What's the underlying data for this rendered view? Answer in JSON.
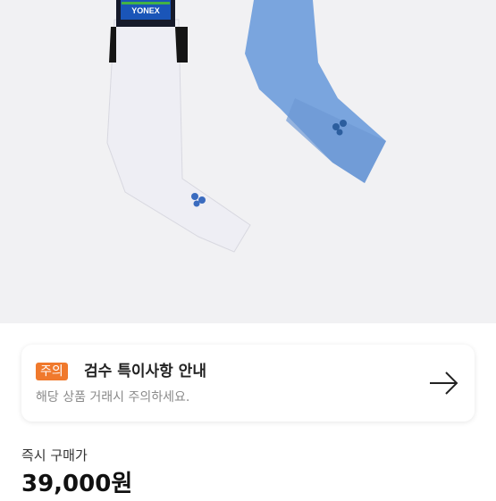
{
  "product": {
    "brand_tag": "YONEX"
  },
  "notice": {
    "badge": "주의",
    "title": "검수 특이사항 안내",
    "description": "해당 상품 거래시 주의하세요."
  },
  "price": {
    "label": "즉시 구매가",
    "value": "39,000원"
  },
  "colors": {
    "badge": "#f0792c",
    "sock_blue": "#7aa5de",
    "sock_white": "#eeeef4",
    "background": "#f1f1f3"
  }
}
